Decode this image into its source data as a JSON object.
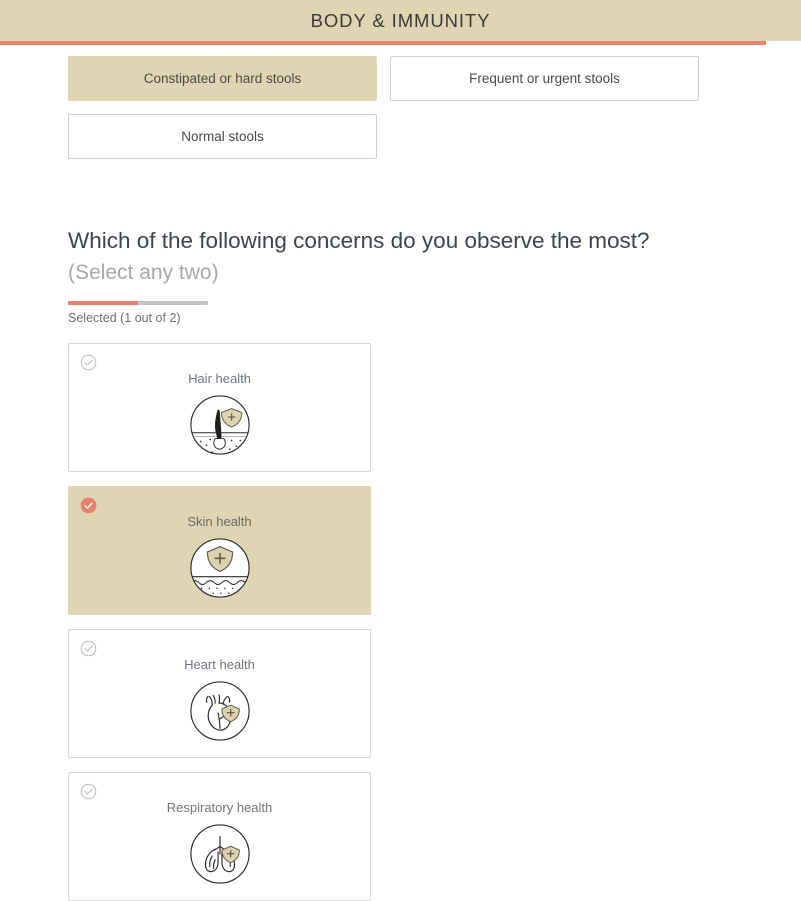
{
  "header": {
    "title": "BODY & IMMUNITY",
    "band_color": "#e0d5b3",
    "progress_color": "#e8816c",
    "progress_percent": 95.6
  },
  "stool_question": {
    "options": [
      {
        "label": "Constipated or hard stools",
        "selected": true
      },
      {
        "label": "Frequent or urgent stools",
        "selected": false
      },
      {
        "label": "Normal stools",
        "selected": false
      }
    ]
  },
  "concern_question": {
    "title": "Which of the following concerns do you observe the most?",
    "hint": "(Select any two)",
    "selected_label": "Selected (1 out of 2)",
    "selected_count": 1,
    "selected_max": 2,
    "progress_percent": 50,
    "progress_fill_color": "#e8816c",
    "progress_track_color": "#c3c3c3",
    "cards": [
      {
        "label": "Hair health",
        "icon": "hair-follicle-icon",
        "selected": false
      },
      {
        "label": "Skin health",
        "icon": "skin-layers-icon",
        "selected": true
      },
      {
        "label": "Heart health",
        "icon": "heart-icon",
        "selected": false
      },
      {
        "label": "Respiratory health",
        "icon": "lungs-icon",
        "selected": false
      }
    ]
  },
  "icons": {
    "check_unselected": "circle-check-outline-icon",
    "check_selected": "circle-check-filled-icon",
    "selected_badge_color": "#e8816c",
    "unselected_check_color": "#b4b4b4",
    "shield_fill": "#ddd2b0"
  }
}
